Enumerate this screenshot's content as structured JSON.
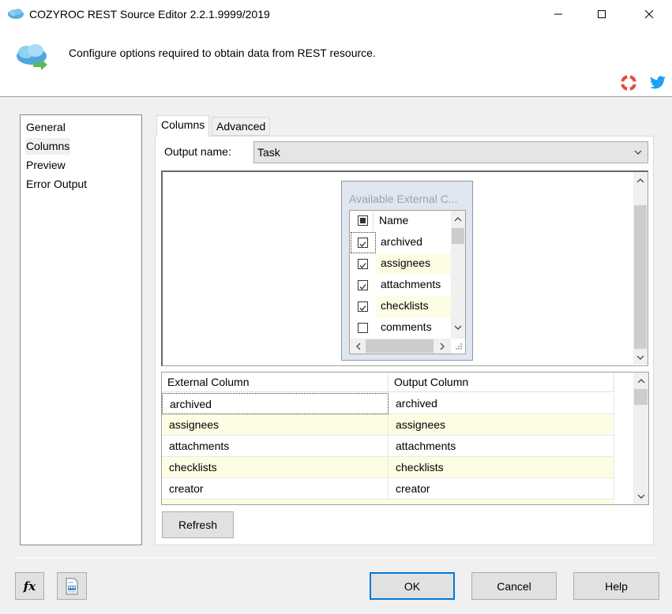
{
  "window": {
    "title": "COZYROC REST Source Editor 2.2.1.9999/2019",
    "minimize_glyph": "—",
    "maximize_glyph": "☐",
    "close_glyph": "✕"
  },
  "header": {
    "description": "Configure options required to obtain data from REST resource."
  },
  "nav": {
    "items": [
      {
        "label": "General"
      },
      {
        "label": "Columns"
      },
      {
        "label": "Preview"
      },
      {
        "label": "Error Output"
      }
    ],
    "selected": "Columns"
  },
  "tabs": [
    {
      "label": "Columns"
    },
    {
      "label": "Advanced"
    }
  ],
  "output": {
    "label": "Output name:",
    "value": "Task"
  },
  "available": {
    "title": "Available External C...",
    "header": "Name",
    "items": [
      {
        "label": "archived",
        "checked": true
      },
      {
        "label": "assignees",
        "checked": true
      },
      {
        "label": "attachments",
        "checked": true
      },
      {
        "label": "checklists",
        "checked": true
      },
      {
        "label": "comments",
        "checked": false
      }
    ]
  },
  "grid": {
    "columns": [
      "External Column",
      "Output Column"
    ],
    "rows": [
      [
        "archived",
        "archived"
      ],
      [
        "assignees",
        "assignees"
      ],
      [
        "attachments",
        "attachments"
      ],
      [
        "checklists",
        "checklists"
      ],
      [
        "creator",
        "creator"
      ]
    ]
  },
  "buttons": {
    "refresh": "Refresh",
    "ok": "OK",
    "cancel": "Cancel",
    "help": "Help",
    "fx": "fx"
  },
  "colors": {
    "alt_row": "#fdfde4",
    "accent": "#0078d7",
    "twitter": "#1da1f2",
    "lifebuoy": "#e8483b"
  }
}
